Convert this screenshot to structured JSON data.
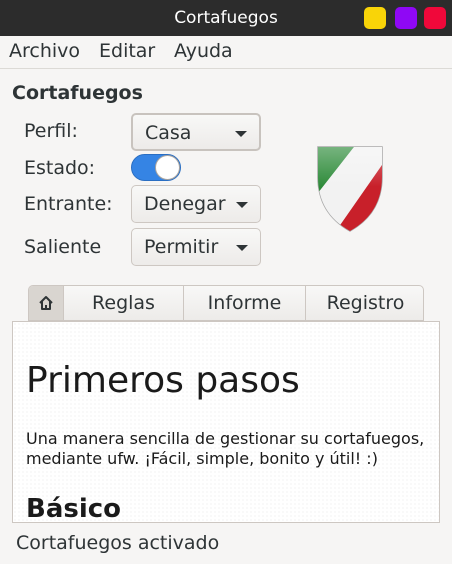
{
  "window": {
    "title": "Cortafuegos"
  },
  "menu": [
    "Archivo",
    "Editar",
    "Ayuda"
  ],
  "section_title": "Cortafuegos",
  "form": {
    "profile_label": "Perfil:",
    "profile_value": "Casa",
    "status_label": "Estado:",
    "status_on": true,
    "incoming_label": "Entrante:",
    "incoming_value": "Denegar",
    "outgoing_label": "Saliente",
    "outgoing_value": "Permitir"
  },
  "tabs": [
    "Reglas",
    "Informe",
    "Registro"
  ],
  "content": {
    "heading": "Primeros pasos",
    "paragraph": "Una manera sencilla de gestionar su cortafuegos, mediante ufw. ¡Fácil, simple, bonito y útil! :)",
    "subheading": "Básico"
  },
  "status": "Cortafuegos activado",
  "colors": {
    "switch_on": "#3584e4",
    "titlebar": "#2c2c2c"
  },
  "icons": {
    "home_tab": "home-icon",
    "logo": "gufw-shield-icon"
  }
}
